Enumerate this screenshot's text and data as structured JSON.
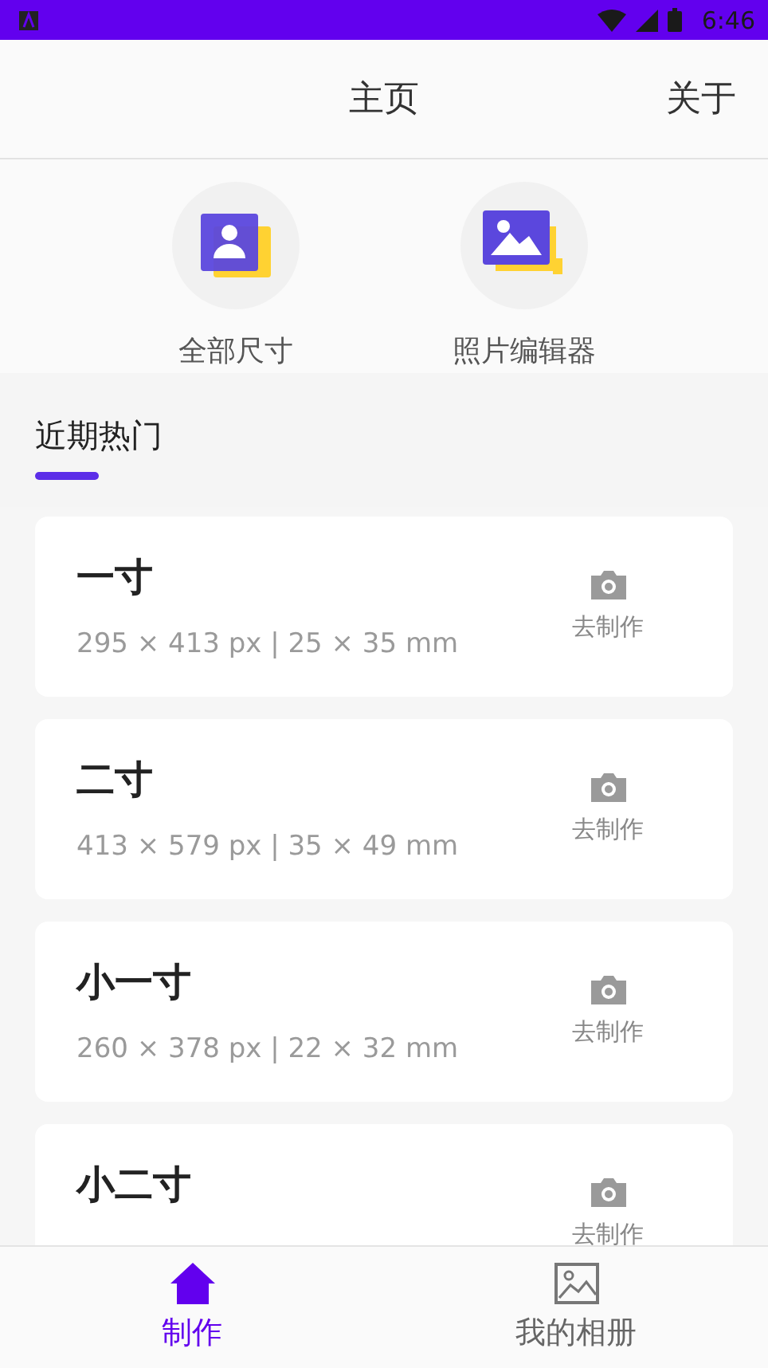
{
  "status_bar": {
    "time": "6:46"
  },
  "header": {
    "title": "主页",
    "action": "关于"
  },
  "shortcuts": [
    {
      "kind": "person",
      "label": "全部尺寸"
    },
    {
      "kind": "image",
      "label": "照片编辑器"
    }
  ],
  "section": {
    "title": "近期热门"
  },
  "sizes": [
    {
      "name": "一寸",
      "dims": "295 × 413 px | 25 × 35 mm",
      "action": "去制作"
    },
    {
      "name": "二寸",
      "dims": "413 × 579 px | 35 × 49 mm",
      "action": "去制作"
    },
    {
      "name": "小一寸",
      "dims": "260 × 378 px | 22 × 32 mm",
      "action": "去制作"
    },
    {
      "name": "小二寸",
      "action": "去制作"
    }
  ],
  "bottom_nav": [
    {
      "kind": "home",
      "label": "制作",
      "selected": true
    },
    {
      "kind": "album",
      "label": "我的相册",
      "selected": false
    }
  ]
}
